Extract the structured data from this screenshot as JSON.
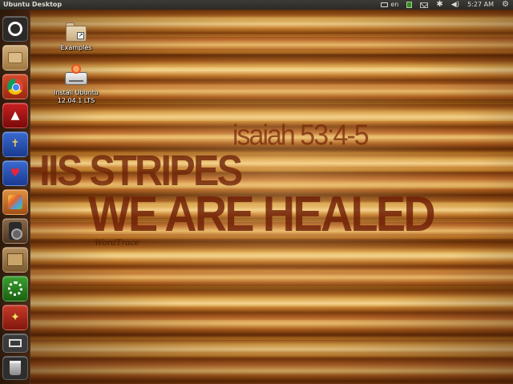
{
  "top_panel": {
    "title": "Ubuntu Desktop",
    "tray": {
      "keyboard_layout": "en",
      "network_icon": "network-icon",
      "mail_icon": "mail-icon",
      "bluetooth_icon": "bluetooth-icon",
      "volume_icon": "volume-icon",
      "clock": "5:27 AM",
      "settings_icon": "gear-icon"
    }
  },
  "wallpaper": {
    "verse_reference": "isaiah 53:4-5",
    "line1": "Y HIS STRIPES",
    "line2": "WE ARE HEALED",
    "signature": "WordTrace"
  },
  "launcher": {
    "items": [
      {
        "name": "dash-home",
        "icon": "ubuntu-logo-icon"
      },
      {
        "name": "files",
        "icon": "home-folder-icon"
      },
      {
        "name": "chromium",
        "icon": "chrome-icon"
      },
      {
        "name": "bible",
        "icon": "bible-icon"
      },
      {
        "name": "prayer",
        "icon": "prayer-icon"
      },
      {
        "name": "heart-app",
        "icon": "heart-icon"
      },
      {
        "name": "image-viewer",
        "icon": "gallery-icon"
      },
      {
        "name": "sound",
        "icon": "speaker-icon"
      },
      {
        "name": "archive",
        "icon": "box-icon"
      },
      {
        "name": "updates",
        "icon": "update-icon"
      },
      {
        "name": "magic-wand",
        "icon": "wand-icon"
      },
      {
        "name": "workspace-switcher",
        "icon": "workspace-icon"
      },
      {
        "name": "trash",
        "icon": "trash-icon"
      }
    ]
  },
  "desktop_icons": [
    {
      "label": "Examples",
      "icon": "folder-link-icon"
    },
    {
      "label": "Install Ubuntu 12.04.1 LTS",
      "icon": "installer-icon"
    }
  ]
}
